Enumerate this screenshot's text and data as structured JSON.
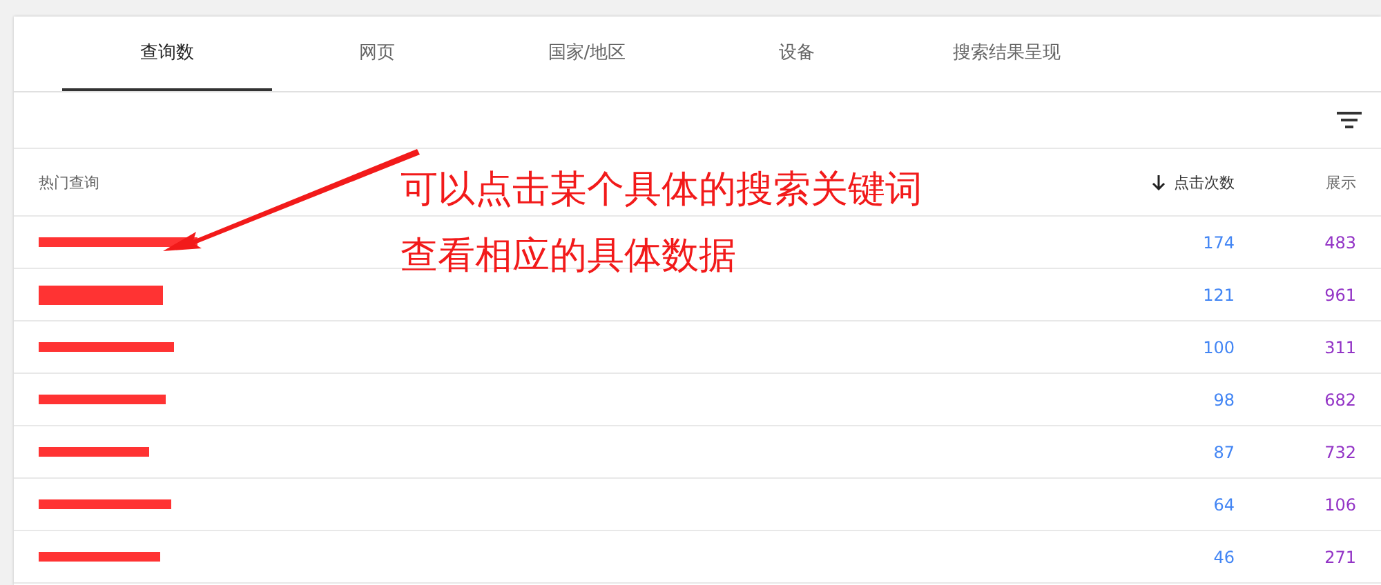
{
  "tabs": [
    {
      "label": "查询数",
      "selected": true
    },
    {
      "label": "网页",
      "selected": false
    },
    {
      "label": "国家/地区",
      "selected": false
    },
    {
      "label": "设备",
      "selected": false
    },
    {
      "label": "搜索结果呈现",
      "selected": false
    }
  ],
  "table": {
    "columns": [
      {
        "label": "热门查询",
        "sorted": false
      },
      {
        "label": "点击次数",
        "sorted": true
      },
      {
        "label": "展示",
        "sorted": false
      }
    ],
    "rows": [
      {
        "clicks": "174",
        "impressions": "483"
      },
      {
        "clicks": "121",
        "impressions": "961"
      },
      {
        "clicks": "100",
        "impressions": "311"
      },
      {
        "clicks": "98",
        "impressions": "682"
      },
      {
        "clicks": "87",
        "impressions": "732"
      },
      {
        "clicks": "64",
        "impressions": "106"
      },
      {
        "clicks": "46",
        "impressions": "271"
      }
    ]
  },
  "annotation": {
    "lines": [
      "可以点击某个具体的搜索关键词",
      "查看相应的具体数据"
    ]
  }
}
